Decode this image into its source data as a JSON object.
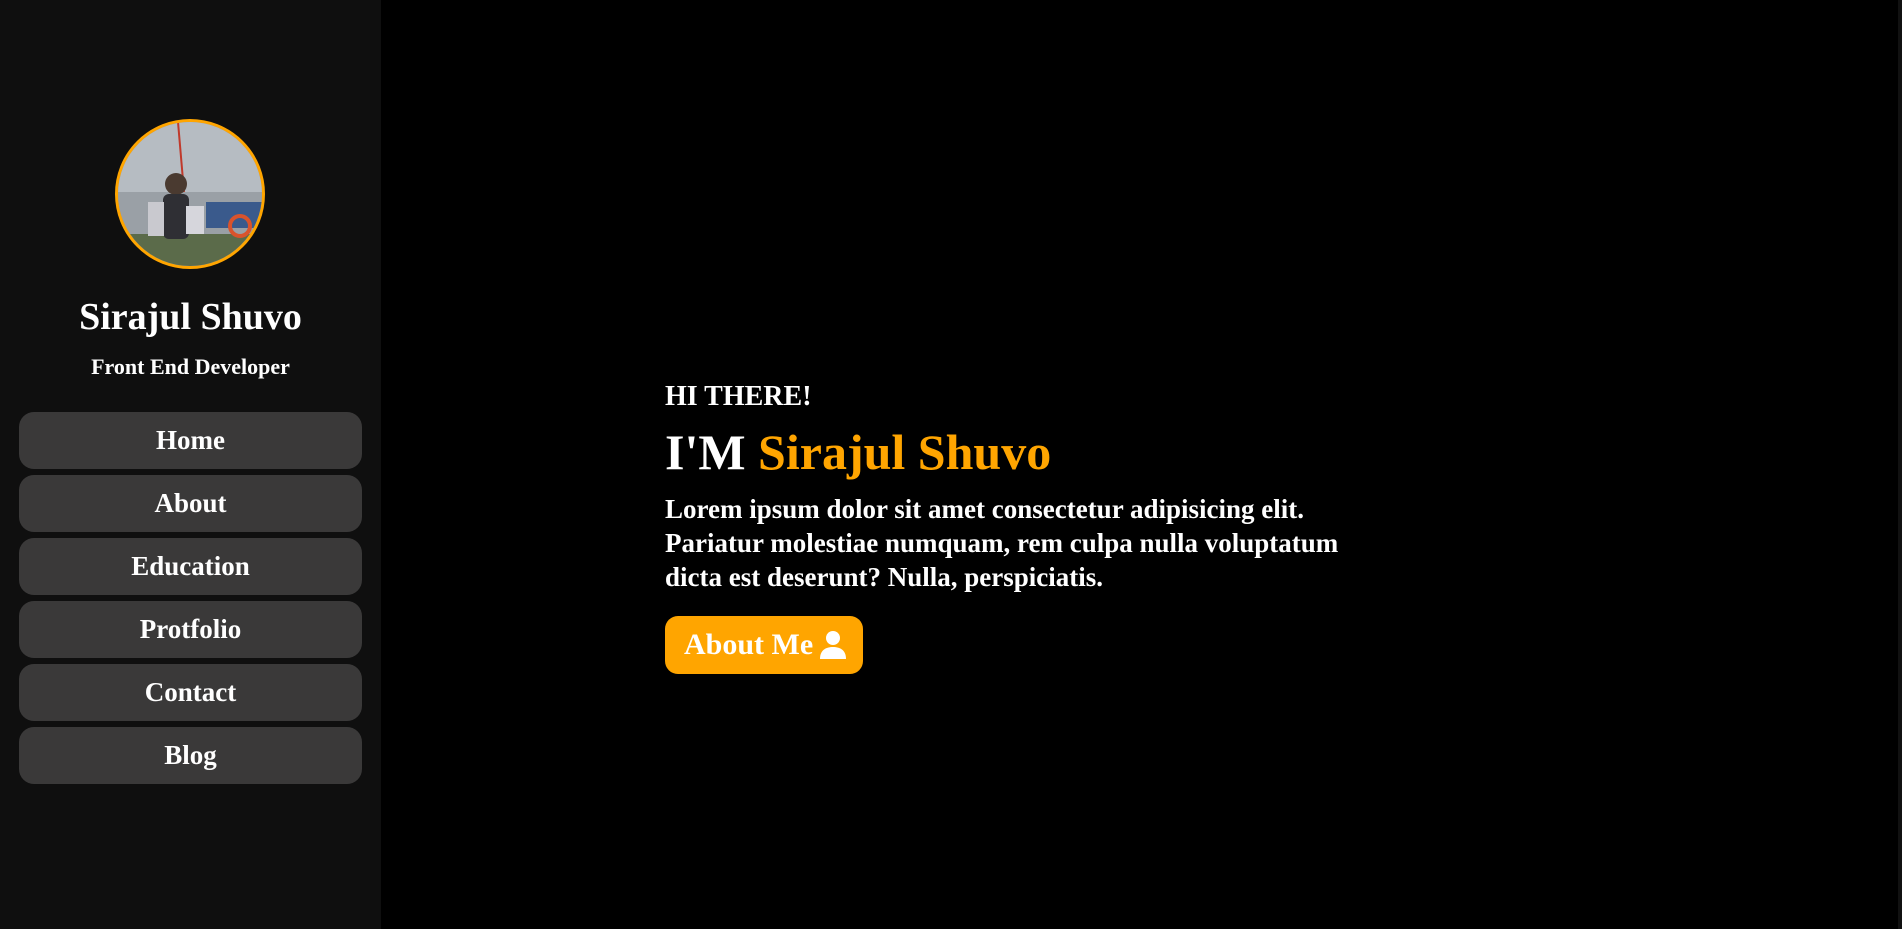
{
  "profile": {
    "name": "Sirajul Shuvo",
    "role": "Front End Developer"
  },
  "nav": {
    "items": [
      {
        "label": "Home"
      },
      {
        "label": "About"
      },
      {
        "label": "Education"
      },
      {
        "label": "Protfolio"
      },
      {
        "label": "Contact"
      },
      {
        "label": "Blog"
      }
    ]
  },
  "hero": {
    "greeting": "HI THERE!",
    "headline_prefix": "I'M",
    "headline_name": "Sirajul Shuvo",
    "intro": "Lorem ipsum dolor sit amet consectetur adipisicing elit. Pariatur molestiae numquam, rem culpa nulla voluptatum dicta est deserunt? Nulla, perspiciatis.",
    "cta_label": "About Me",
    "cta_icon": "user-icon"
  },
  "colors": {
    "accent": "#ffa500",
    "sidebar_bg": "#0f0f0f",
    "nav_item_bg": "#3a3939",
    "page_bg": "#000000"
  }
}
